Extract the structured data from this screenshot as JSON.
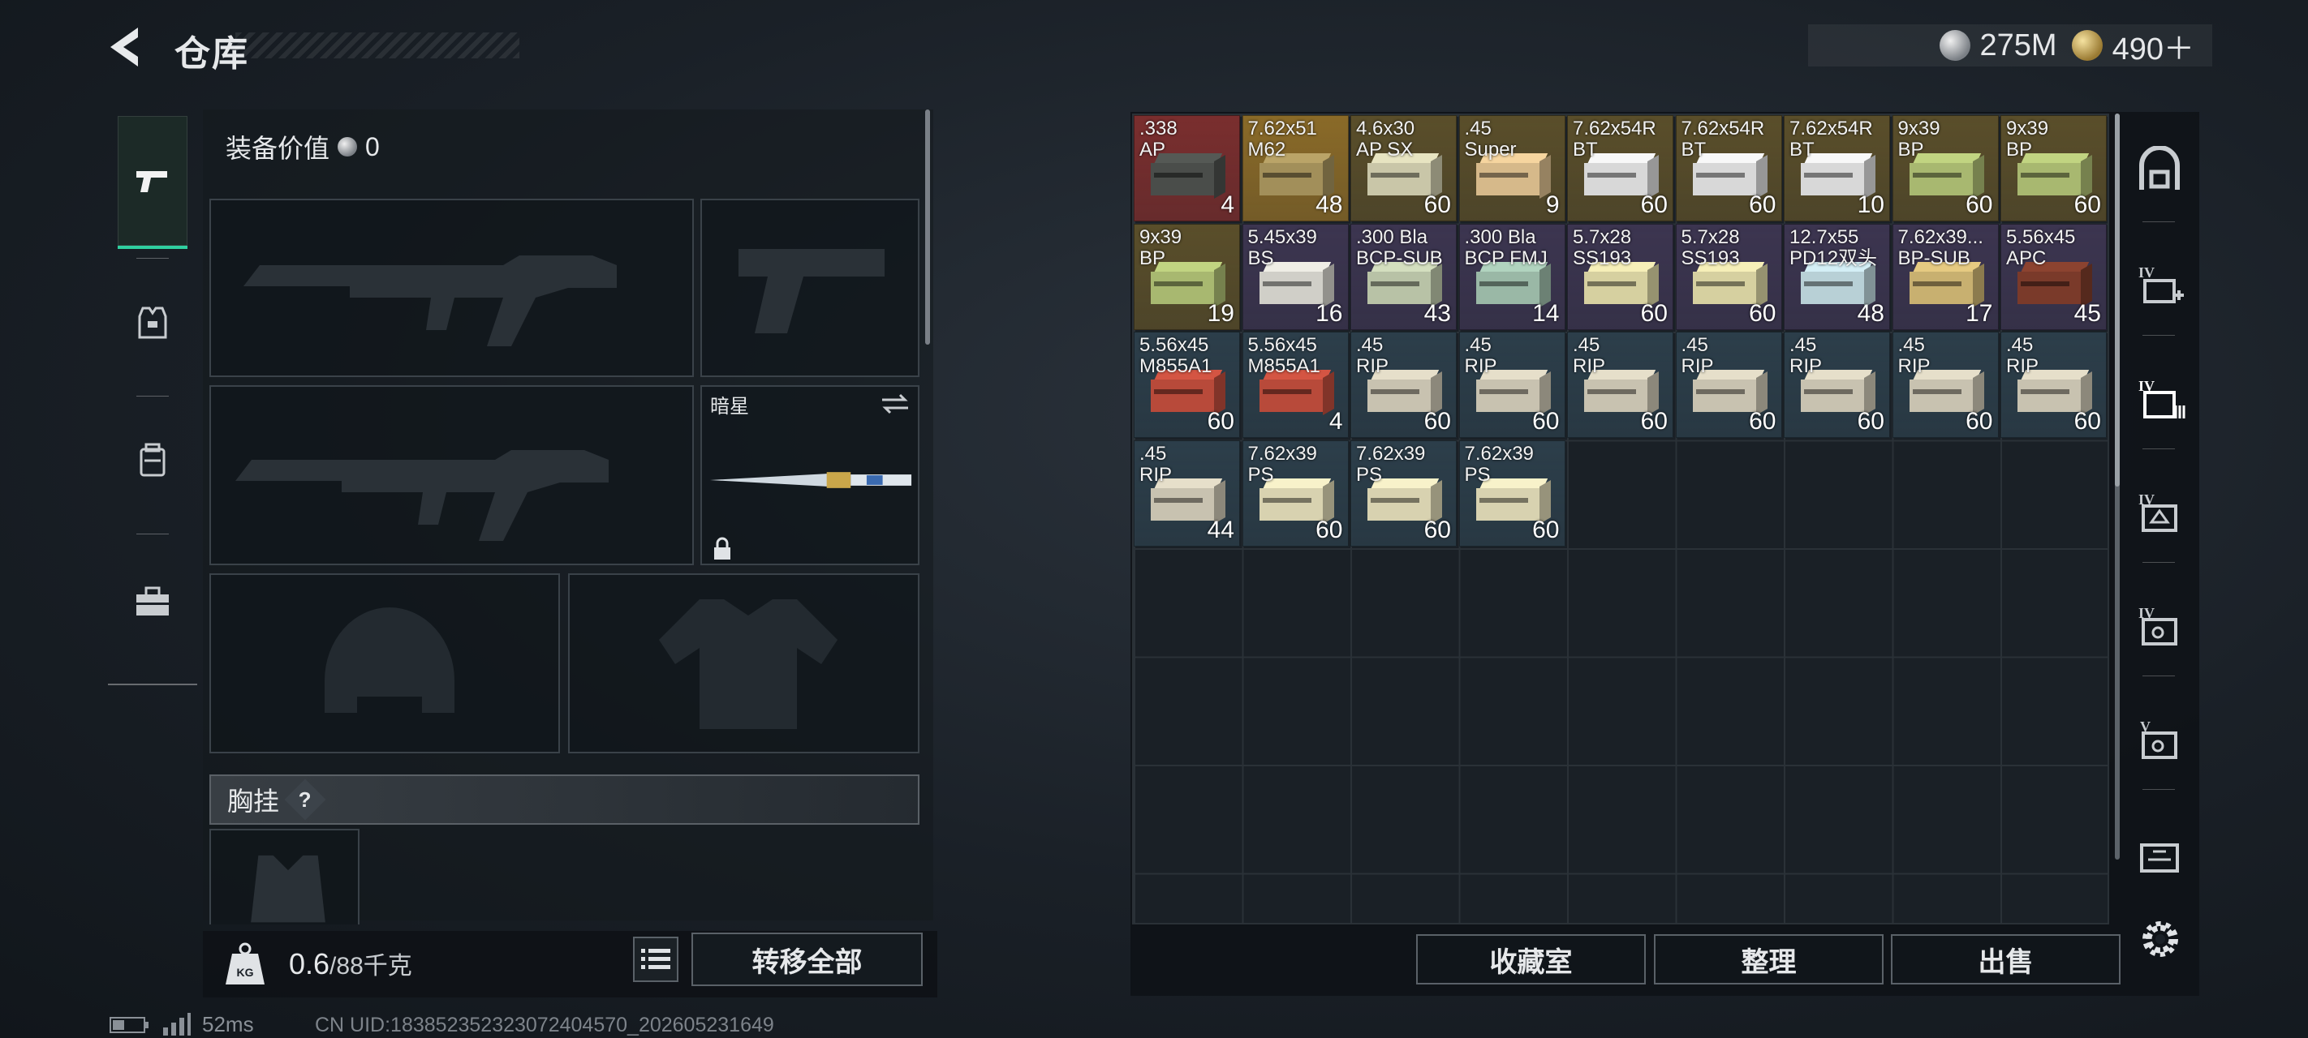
{
  "header": {
    "title": "仓库"
  },
  "currency": [
    {
      "icon": "silver-coin-icon",
      "value": "275M"
    },
    {
      "icon": "gold-coin-icon",
      "value": "490＋"
    }
  ],
  "left_nav": [
    {
      "name": "weapon",
      "icon": "pistol-icon",
      "active": true
    },
    {
      "name": "armor",
      "icon": "armor-vest-icon",
      "active": false
    },
    {
      "name": "backpack",
      "icon": "backpack-icon",
      "active": false
    },
    {
      "name": "toolbox",
      "icon": "toolbox-icon",
      "active": false
    }
  ],
  "equipment": {
    "value_label": "装备价值",
    "value": "0",
    "melee_name": "暗星",
    "chest_label": "胸挂",
    "chest_help": "?"
  },
  "weight": {
    "current": "0.6",
    "max_unit": "/88千克",
    "kg_label": "KG"
  },
  "actions": {
    "transfer_all": "转移全部",
    "favorites": "收藏室",
    "sort": "整理",
    "sell": "出售"
  },
  "status": {
    "ping": "52ms",
    "uid": "CN UID:18385235232307240457​0_202605231649"
  },
  "ammo": [
    {
      "name": ".338\nAP",
      "count": "4",
      "color": "#7a2e2e",
      "box": "#4a4d4a"
    },
    {
      "name": "7.62x51\nM62",
      "count": "48",
      "color": "#8a6a28",
      "box": "#a28f5a"
    },
    {
      "name": "4.6x30\nAP SX",
      "count": "60",
      "color": "#5a4e2a",
      "box": "#c9c6a8"
    },
    {
      "name": ".45\nSuper",
      "count": "9",
      "color": "#5a4e2a",
      "box": "#d6b98a"
    },
    {
      "name": "7.62x54R\nBT",
      "count": "60",
      "color": "#5a4e2a",
      "box": "#d8d8d8"
    },
    {
      "name": "7.62x54R\nBT",
      "count": "60",
      "color": "#5a4e2a",
      "box": "#d8d8d8"
    },
    {
      "name": "7.62x54R\nBT",
      "count": "10",
      "color": "#5a4e2a",
      "box": "#d8d8d8"
    },
    {
      "name": "9x39\nBP",
      "count": "60",
      "color": "#5a4e2a",
      "box": "#a8b870"
    },
    {
      "name": "9x39\nBP",
      "count": "60",
      "color": "#5a4e2a",
      "box": "#a8b870"
    },
    {
      "name": "9x39\nBP",
      "count": "19",
      "color": "#5a4e2a",
      "box": "#a8b870"
    },
    {
      "name": "5.45x39\nBS",
      "count": "16",
      "color": "#3c3550",
      "box": "#d0cfc8"
    },
    {
      "name": ".300 Bla\nBCP-SUB",
      "count": "43",
      "color": "#3c3550",
      "box": "#b8c2a6"
    },
    {
      "name": ".300 Bla\nBCP FMJ",
      "count": "14",
      "color": "#3c3550",
      "box": "#9ab8a6"
    },
    {
      "name": "5.7x28\nSS193",
      "count": "60",
      "color": "#3c3550",
      "box": "#d6d0a0"
    },
    {
      "name": "5.7x28\nSS193",
      "count": "60",
      "color": "#3c3550",
      "box": "#d6d0a0"
    },
    {
      "name": "12.7x55\nPD12双头",
      "count": "48",
      "color": "#3c3550",
      "box": "#b8d0d6"
    },
    {
      "name": "7.62x39...\nBP-SUB",
      "count": "17",
      "color": "#3c3550",
      "box": "#c8b070"
    },
    {
      "name": "5.56x45\nAPC",
      "count": "45",
      "color": "#3c3550",
      "box": "#7a3a2a"
    },
    {
      "name": "5.56x45\nM855A1",
      "count": "60",
      "color": "#2c3e4a",
      "box": "#b84a3a"
    },
    {
      "name": "5.56x45\nM855A1",
      "count": "4",
      "color": "#2c3e4a",
      "box": "#b84a3a"
    },
    {
      "name": ".45\nRIP",
      "count": "60",
      "color": "#2c3e4a",
      "box": "#c8c2b0"
    },
    {
      "name": ".45\nRIP",
      "count": "60",
      "color": "#2c3e4a",
      "box": "#c8c2b0"
    },
    {
      "name": ".45\nRIP",
      "count": "60",
      "color": "#2c3e4a",
      "box": "#c8c2b0"
    },
    {
      "name": ".45\nRIP",
      "count": "60",
      "color": "#2c3e4a",
      "box": "#c8c2b0"
    },
    {
      "name": ".45\nRIP",
      "count": "60",
      "color": "#2c3e4a",
      "box": "#c8c2b0"
    },
    {
      "name": ".45\nRIP",
      "count": "60",
      "color": "#2c3e4a",
      "box": "#c8c2b0"
    },
    {
      "name": ".45\nRIP",
      "count": "60",
      "color": "#2c3e4a",
      "box": "#c8c2b0"
    },
    {
      "name": ".45\nRIP",
      "count": "44",
      "color": "#2c3e4a",
      "box": "#c8c2b0"
    },
    {
      "name": "7.62x39\nPS",
      "count": "60",
      "color": "#2c3e4a",
      "box": "#d8d2b0"
    },
    {
      "name": "7.62x39\nPS",
      "count": "60",
      "color": "#2c3e4a",
      "box": "#d8d2b0"
    },
    {
      "name": "7.62x39\nPS",
      "count": "60",
      "color": "#2c3e4a",
      "box": "#d8d2b0"
    }
  ],
  "right_nav": [
    {
      "name": "right-nav-safe",
      "icon": "safe-icon"
    },
    {
      "name": "right-nav-medical-iv",
      "icon": "medical-kit-icon"
    },
    {
      "name": "right-nav-ammo-iv",
      "icon": "ammo-box-icon"
    },
    {
      "name": "right-nav-armor-iv",
      "icon": "armor-icon"
    },
    {
      "name": "right-nav-tools-iv",
      "icon": "tool-icon"
    },
    {
      "name": "right-nav-tools-v",
      "icon": "tool-icon"
    },
    {
      "name": "right-nav-misc",
      "icon": "crate-icon"
    }
  ]
}
